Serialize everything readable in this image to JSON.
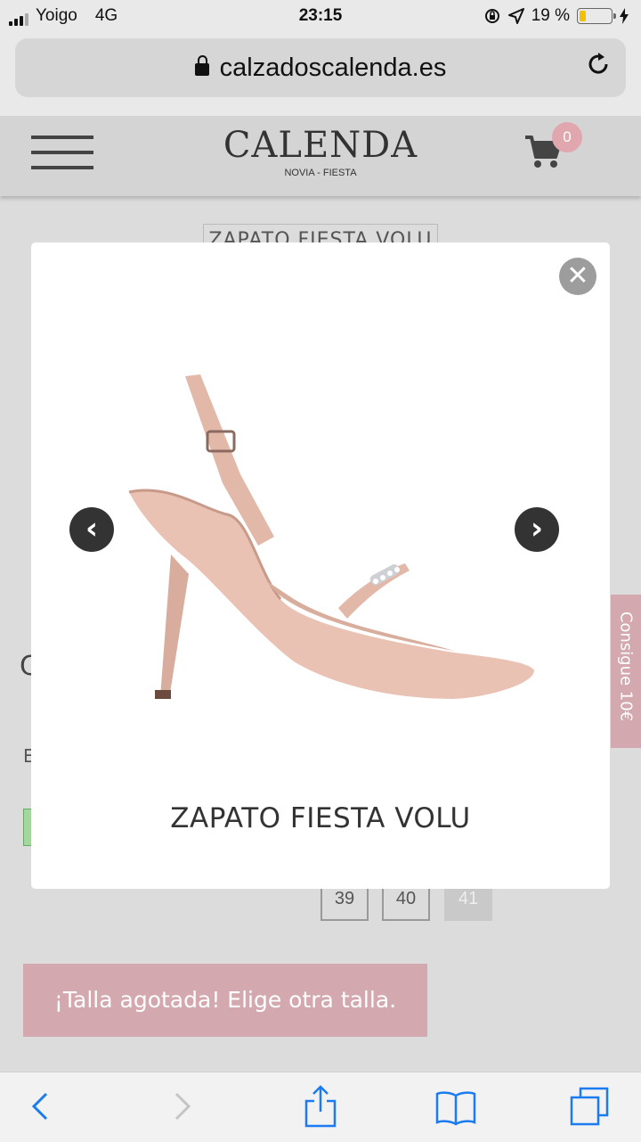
{
  "status_bar": {
    "carrier": "Yoigo",
    "network": "4G",
    "time": "23:15",
    "battery_percent": "19 %",
    "battery_level": 0.19,
    "icons": [
      "signal-icon",
      "orientation-lock-icon",
      "location-icon",
      "battery-icon",
      "charging-icon"
    ]
  },
  "browser": {
    "url": "calzadoscalenda.es",
    "icons": [
      "lock-icon",
      "reload-icon"
    ]
  },
  "header": {
    "logo_name": "CALENDA",
    "logo_subtitle": "NOVIA - FIESTA",
    "cart_count": "0",
    "icons": [
      "menu-icon",
      "cart-icon"
    ]
  },
  "page": {
    "title_partial": "ZAPATO FIESTA VOLU",
    "side_tab": "Consigue 10€",
    "heading_initial": "C",
    "text_initial": "E",
    "sizes": [
      {
        "label": "39",
        "available": true
      },
      {
        "label": "40",
        "available": true
      },
      {
        "label": "41",
        "available": false
      }
    ],
    "soldout_message": "¡Talla agotada! Elige otra talla."
  },
  "modal": {
    "caption": "ZAPATO FIESTA VOLU",
    "shoe_color": "#e9c2b4",
    "icons": [
      "close-icon",
      "chevron-left-icon",
      "chevron-right-icon"
    ]
  },
  "toolbar": {
    "accent": "#1a7cf0",
    "icons": [
      "back-icon",
      "forward-icon",
      "share-icon",
      "bookmarks-icon",
      "tabs-icon"
    ]
  }
}
